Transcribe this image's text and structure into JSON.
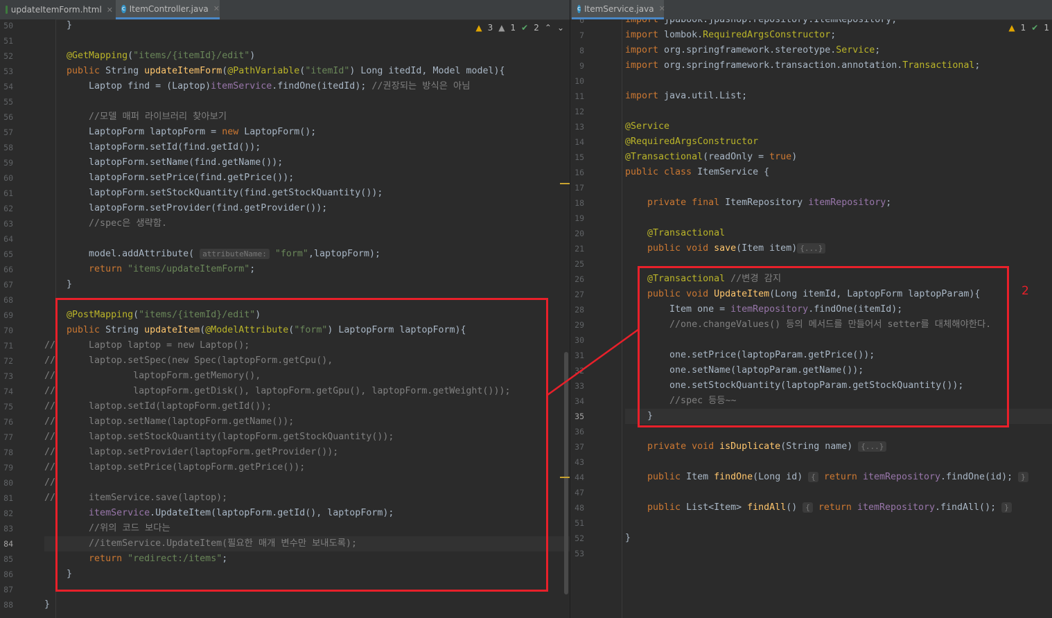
{
  "tabs_left": [
    {
      "label": "updateItemForm.html",
      "icon": "html-file-icon"
    },
    {
      "label": "ItemController.java",
      "icon": "java-class-icon",
      "active": true
    }
  ],
  "tabs_right": [
    {
      "label": "ItemService.java",
      "icon": "java-class-icon",
      "active": true
    }
  ],
  "left_status": {
    "warnings": "3",
    "weak": "1",
    "typos": "2"
  },
  "right_status": {
    "warnings": "1",
    "typos": "1"
  },
  "annotation_number": "2",
  "left_code": [
    {
      "n": "50",
      "html": "    }"
    },
    {
      "n": "51",
      "html": ""
    },
    {
      "n": "52",
      "html": "    <span class=\"an\">@GetMapping</span>(<span class=\"st\">\"items/{itemId}/edit\"</span>)"
    },
    {
      "n": "53",
      "html": "    <span class=\"kw\">public</span> String <span class=\"fn\">updateItemForm</span>(<span class=\"an\">@PathVariable</span>(<span class=\"st\">\"itemId\"</span>) Long itedId, Model model){"
    },
    {
      "n": "54",
      "html": "        Laptop find = (Laptop)<span class=\"fd\">itemService</span>.findOne(itedId); <span class=\"cm\">//권장되는 방식은 아님</span>"
    },
    {
      "n": "55",
      "html": ""
    },
    {
      "n": "56",
      "html": "        <span class=\"cm\">//모델 매퍼 라이브러리 찾아보기</span>"
    },
    {
      "n": "57",
      "html": "        LaptopForm laptopForm = <span class=\"kw\">new</span> LaptopForm();"
    },
    {
      "n": "58",
      "html": "        laptopForm.setId(find.getId());"
    },
    {
      "n": "59",
      "html": "        laptopForm.setName(find.getName());"
    },
    {
      "n": "60",
      "html": "        laptopForm.setPrice(find.getPrice());"
    },
    {
      "n": "61",
      "html": "        laptopForm.setStockQuantity(find.getStockQuantity());"
    },
    {
      "n": "62",
      "html": "        laptopForm.setProvider(find.getProvider());"
    },
    {
      "n": "63",
      "html": "        <span class=\"cm\">//spec은 생략함.</span>"
    },
    {
      "n": "64",
      "html": ""
    },
    {
      "n": "65",
      "html": "        model.addAttribute( <span class=\"hint\">attributeName:</span> <span class=\"st\">\"form\"</span>,laptopForm);"
    },
    {
      "n": "66",
      "html": "        <span class=\"kw\">return</span> <span class=\"st\">\"items/updateItemForm\"</span>;"
    },
    {
      "n": "67",
      "html": "    }"
    },
    {
      "n": "68",
      "html": ""
    },
    {
      "n": "69",
      "html": "    <span class=\"an\">@PostMapping</span>(<span class=\"st\">\"items/{itemId}/edit\"</span>)"
    },
    {
      "n": "70",
      "html": "    <span class=\"kw\">public</span> String <span class=\"fn\">updateItem</span>(<span class=\"an\">@ModelAttribute</span>(<span class=\"st\">\"form\"</span>) LaptopForm laptopForm){"
    },
    {
      "n": "71",
      "html": "<span class=\"cm\">//      Laptop laptop = new Laptop();</span>"
    },
    {
      "n": "72",
      "html": "<span class=\"cm\">//      laptop.setSpec(new Spec(laptopForm.getCpu(),</span>"
    },
    {
      "n": "73",
      "html": "<span class=\"cm\">//              laptopForm.getMemory(),</span>"
    },
    {
      "n": "74",
      "html": "<span class=\"cm\">//              laptopForm.getDisk(), laptopForm.getGpu(), laptopForm.getWeight()));</span>"
    },
    {
      "n": "75",
      "html": "<span class=\"cm\">//      laptop.setId(laptopForm.getId());</span>"
    },
    {
      "n": "76",
      "html": "<span class=\"cm\">//      laptop.setName(laptopForm.getName());</span>"
    },
    {
      "n": "77",
      "html": "<span class=\"cm\">//      laptop.setStockQuantity(laptopForm.getStockQuantity());</span>"
    },
    {
      "n": "78",
      "html": "<span class=\"cm\">//      laptop.setProvider(laptopForm.getProvider());</span>"
    },
    {
      "n": "79",
      "html": "<span class=\"cm\">//      laptop.setPrice(laptopForm.getPrice());</span>"
    },
    {
      "n": "80",
      "html": "<span class=\"cm\">//</span>"
    },
    {
      "n": "81",
      "html": "<span class=\"cm\">//      itemService.save(laptop);</span>"
    },
    {
      "n": "82",
      "html": "        <span class=\"fd\">itemService</span>.UpdateItem(laptopForm.getId(), laptopForm);"
    },
    {
      "n": "83",
      "html": "        <span class=\"cm\">//위의 코드 보다는</span>"
    },
    {
      "n": "84",
      "html": "        <span class=\"cm\">//itemService.UpdateItem(필요한 매개 변수만 보내도록);</span>",
      "cur": true
    },
    {
      "n": "85",
      "html": "        <span class=\"kw\">return</span> <span class=\"st\">\"redirect:/items\"</span>;"
    },
    {
      "n": "86",
      "html": "    }"
    },
    {
      "n": "87",
      "html": ""
    },
    {
      "n": "88",
      "html": "}"
    }
  ],
  "right_code": [
    {
      "n": "6",
      "html": "<span class=\"kw\">import</span> jpabook.jpashop.repository.ItemRepository;"
    },
    {
      "n": "7",
      "html": "<span class=\"kw\">import</span> lombok.<span class=\"an\">RequiredArgsConstructor</span>;"
    },
    {
      "n": "8",
      "html": "<span class=\"kw\">import</span> org.springframework.stereotype.<span class=\"an\">Service</span>;"
    },
    {
      "n": "9",
      "html": "<span class=\"kw\">import</span> org.springframework.transaction.annotation.<span class=\"an\">Transactional</span>;"
    },
    {
      "n": "10",
      "html": ""
    },
    {
      "n": "11",
      "html": "<span class=\"kw\">import</span> java.util.List;"
    },
    {
      "n": "12",
      "html": ""
    },
    {
      "n": "13",
      "html": "<span class=\"an\">@Service</span>"
    },
    {
      "n": "14",
      "html": "<span class=\"an\">@RequiredArgsConstructor</span>"
    },
    {
      "n": "15",
      "html": "<span class=\"an\">@Transactional</span>(readOnly = <span class=\"kw\">true</span>)"
    },
    {
      "n": "16",
      "html": "<span class=\"kw\">public class</span> ItemService {"
    },
    {
      "n": "17",
      "html": ""
    },
    {
      "n": "18",
      "html": "    <span class=\"kw\">private final</span> ItemRepository <span class=\"fd\">itemRepository</span>;"
    },
    {
      "n": "19",
      "html": ""
    },
    {
      "n": "20",
      "html": "    <span class=\"an\">@Transactional</span>"
    },
    {
      "n": "21",
      "html": "    <span class=\"kw\">public void</span> <span class=\"fn\">save</span>(Item item)<span class=\"hint\">{...}</span>"
    },
    {
      "n": "25",
      "html": ""
    },
    {
      "n": "26",
      "html": "    <span class=\"an\">@Transactional</span> <span class=\"cm\">//변경 감지</span>"
    },
    {
      "n": "27",
      "html": "    <span class=\"kw\">public void</span> <span class=\"fn\">UpdateItem</span>(Long itemId, LaptopForm laptopParam){"
    },
    {
      "n": "28",
      "html": "        Item one = <span class=\"fd\">itemRepository</span>.findOne(itemId);"
    },
    {
      "n": "29",
      "html": "        <span class=\"cm\">//one.changeValues() 등의 메서드를 만들어서 setter를 대체해야한다.</span>"
    },
    {
      "n": "30",
      "html": ""
    },
    {
      "n": "31",
      "html": "        one.setPrice(laptopParam.getPrice());"
    },
    {
      "n": "32",
      "html": "        one.setName(laptopParam.getName());"
    },
    {
      "n": "33",
      "html": "        one.setStockQuantity(laptopParam.getStockQuantity());"
    },
    {
      "n": "34",
      "html": "        <span class=\"cm\">//spec 등등~~</span>"
    },
    {
      "n": "35",
      "html": "    }",
      "cur": true
    },
    {
      "n": "36",
      "html": ""
    },
    {
      "n": "37",
      "html": "    <span class=\"kw\">private void</span> <span class=\"fn\">isDuplicate</span>(String name) <span class=\"hint\">{...}</span>"
    },
    {
      "n": "43",
      "html": ""
    },
    {
      "n": "44",
      "html": "    <span class=\"kw\">public</span> Item <span class=\"fn\">findOne</span>(Long id) <span class=\"hint\">{</span> <span class=\"kw\">return</span> <span class=\"fd\">itemRepository</span>.findOne(id); <span class=\"hint\">}</span>"
    },
    {
      "n": "47",
      "html": ""
    },
    {
      "n": "48",
      "html": "    <span class=\"kw\">public</span> List&lt;Item&gt; <span class=\"fn\">findAll</span>() <span class=\"hint\">{</span> <span class=\"kw\">return</span> <span class=\"fd\">itemRepository</span>.findAll(); <span class=\"hint\">}</span>"
    },
    {
      "n": "51",
      "html": ""
    },
    {
      "n": "52",
      "html": "}"
    },
    {
      "n": "53",
      "html": ""
    }
  ]
}
